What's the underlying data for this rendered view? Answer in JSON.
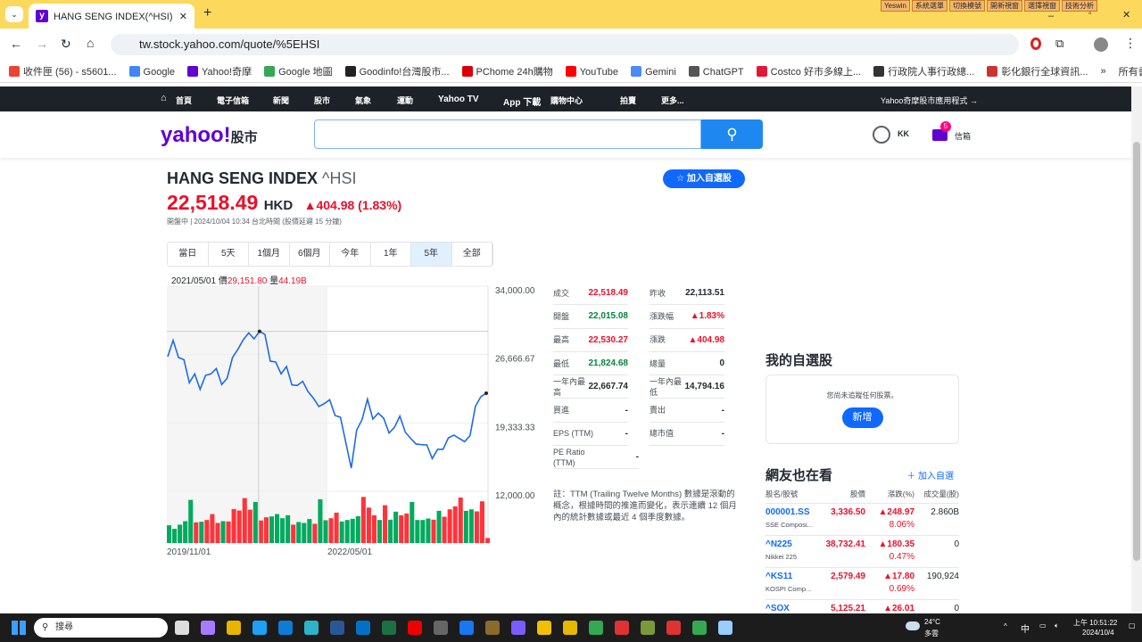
{
  "browser": {
    "tab_title": "HANG SENG INDEX(^HSI) 走勢",
    "url": "tw.stock.yahoo.com/quote/%5EHSI",
    "yeswin": [
      "Yeswin",
      "系統選單",
      "切換模號",
      "開新視窗",
      "選擇視窗",
      "技術分析"
    ],
    "bookmarks": [
      "收件匣 (56) - s5601...",
      "Google",
      "Yahoo!奇摩",
      "Google 地圖",
      "Goodinfo!台灣股市...",
      "PChome 24h購物",
      "YouTube",
      "Gemini",
      "ChatGPT",
      "Costco 好市多線上...",
      "行政院人事行政總...",
      "彰化銀行全球資訊..."
    ],
    "bookmarks_more": "»",
    "all_bookmarks": "所有書籤"
  },
  "nav": {
    "items": [
      "首頁",
      "電子信箱",
      "新聞",
      "股市",
      "氣象",
      "運動",
      "Yahoo TV",
      "App 下載",
      "購物中心",
      "拍賣",
      "更多..."
    ],
    "app_link": "Yahoo奇摩股市應用程式 →"
  },
  "header": {
    "logo": "yahoo!",
    "logo_sub": "股市",
    "user": "KK",
    "mail_label": "信箱",
    "mail_count": "5"
  },
  "quote": {
    "name": "HANG SENG INDEX",
    "symbol": "^HSI",
    "price": "22,518.49",
    "currency": "HKD",
    "change": "▲404.98 (1.83%)",
    "status": "開盤中 | 2024/10/04 10:34 台北時間 (股價延遲 15 分鐘)",
    "watch_button": "☆ 加入自選股"
  },
  "ranges": [
    "當日",
    "5天",
    "1個月",
    "6個月",
    "今年",
    "1年",
    "5年",
    "全部"
  ],
  "active_range": "5年",
  "tooltip": {
    "date": "2021/05/01",
    "price_label": "價",
    "price": "29,151.80",
    "vol_label": "量",
    "vol": "44.19B"
  },
  "stats": [
    [
      {
        "l": "成交",
        "v": "22,518.49",
        "c": "red"
      },
      {
        "l": "昨收",
        "v": "22,113.51",
        "c": ""
      }
    ],
    [
      {
        "l": "開盤",
        "v": "22,015.08",
        "c": "grn"
      },
      {
        "l": "漲跌幅",
        "v": "▲1.83%",
        "c": "red"
      }
    ],
    [
      {
        "l": "最高",
        "v": "22,530.27",
        "c": "red"
      },
      {
        "l": "漲跌",
        "v": "▲404.98",
        "c": "red"
      }
    ],
    [
      {
        "l": "最低",
        "v": "21,824.68",
        "c": "grn"
      },
      {
        "l": "總量",
        "v": "0",
        "c": ""
      }
    ],
    [
      {
        "l": "一年內最高",
        "v": "22,667.74",
        "c": ""
      },
      {
        "l": "一年內最低",
        "v": "14,794.16",
        "c": ""
      }
    ],
    [
      {
        "l": "買進",
        "v": "-",
        "c": ""
      },
      {
        "l": "賣出",
        "v": "-",
        "c": ""
      }
    ],
    [
      {
        "l": "EPS (TTM)",
        "v": "-",
        "c": ""
      },
      {
        "l": "總市值",
        "v": "-",
        "c": ""
      }
    ],
    [
      {
        "l": "PE Ratio (TTM)",
        "v": "-",
        "c": ""
      }
    ]
  ],
  "note": "註：TTM (Trailing Twelve Months) 數據是滾動的概念，根據時間的推進而變化，表示連續 12 個月內的統計數據或最近 4 個季度數據。",
  "watchlist": {
    "title": "我的自選股",
    "empty": "您尚未追蹤任何股票。",
    "add": "新增"
  },
  "also": {
    "title": "網友也在看",
    "add": "＋ 加入自選",
    "headers": [
      "股名/股號",
      "股價",
      "漲跌(%)",
      "成交量(股)"
    ],
    "rows": [
      {
        "sym": "000001.SS",
        "name": "SSE Composi...",
        "price": "3,336.50",
        "chg": "▲248.97",
        "pct": "8.06%",
        "vol": "2.860B"
      },
      {
        "sym": "^N225",
        "name": "Nikkei 225",
        "price": "38,732.41",
        "chg": "▲180.35",
        "pct": "0.47%",
        "vol": "0"
      },
      {
        "sym": "^KS11",
        "name": "KOSPI Comp...",
        "price": "2,579.49",
        "chg": "▲17.80",
        "pct": "0.69%",
        "vol": "190,924"
      },
      {
        "sym": "^SOX",
        "name": "",
        "price": "5,125.21",
        "chg": "▲26.01",
        "pct": "",
        "vol": "0"
      }
    ]
  },
  "taskbar": {
    "search": "搜尋",
    "weather": "24°C",
    "weather_desc": "多雲",
    "time": "上午 10:51:22",
    "date": "2024/10/4",
    "ime": "中"
  },
  "chart_data": {
    "type": "line",
    "title": "HANG SENG INDEX 5年",
    "x_labels": [
      "2019/11/01",
      "2022/05/01"
    ],
    "y_ticks": [
      "34,000.00",
      "26,666.67",
      "19,333.33",
      "12,000.00"
    ],
    "ylim": [
      12000,
      34000
    ],
    "highlight_index": 17,
    "colors": {
      "line": "#1e6be6",
      "up": "#ff333a",
      "down": "#00ab5e"
    },
    "values": [
      26444,
      28198,
      26349,
      26126,
      23639,
      24596,
      22937,
      24436,
      24596,
      25169,
      23448,
      24117,
      26349,
      27241,
      28262,
      28995,
      28357,
      29152,
      28835,
      25966,
      25871,
      24596,
      25393,
      23416,
      23352,
      23798,
      22683,
      21981,
      21089,
      21407,
      21822,
      20132,
      19941,
      17199,
      14490,
      18570,
      19686,
      21886,
      19750,
      20387,
      19845,
      18251,
      18857,
      20068,
      18347,
      17678,
      17072,
      17008,
      16976,
      15510,
      16498,
      16498,
      17741,
      18028,
      17678,
      17327,
      17964,
      21120,
      22141,
      22518
    ],
    "volume_b": [
      34.8,
      27.8,
      36.0,
      42.9,
      84.7,
      40.6,
      41.8,
      45.2,
      56.8,
      39.4,
      42.9,
      42.3,
      66.7,
      63.8,
      88.2,
      65.5,
      80.6,
      44.2,
      50.5,
      52.2,
      56.8,
      48.7,
      54.5,
      36.0,
      41.2,
      39.4,
      47.0,
      37.7,
      85.8,
      44.7,
      48.7,
      59.7,
      42.3,
      45.2,
      47.6,
      52.8,
      90.5,
      69.6,
      54.5,
      45.2,
      74.2,
      45.8,
      61.5,
      54.5,
      58.0,
      80.6,
      45.2,
      45.2,
      48.1,
      45.8,
      63.2,
      51.6,
      66.1,
      71.9,
      89.3,
      63.2,
      66.1,
      62.1,
      81.8,
      9.9
    ],
    "volume_dir": "gggggrgrrrgrrrrrgrrggggrgggrggrrggggrrrgrggrrggggrgrrrrggrrr",
    "volume_max": 101.5
  }
}
